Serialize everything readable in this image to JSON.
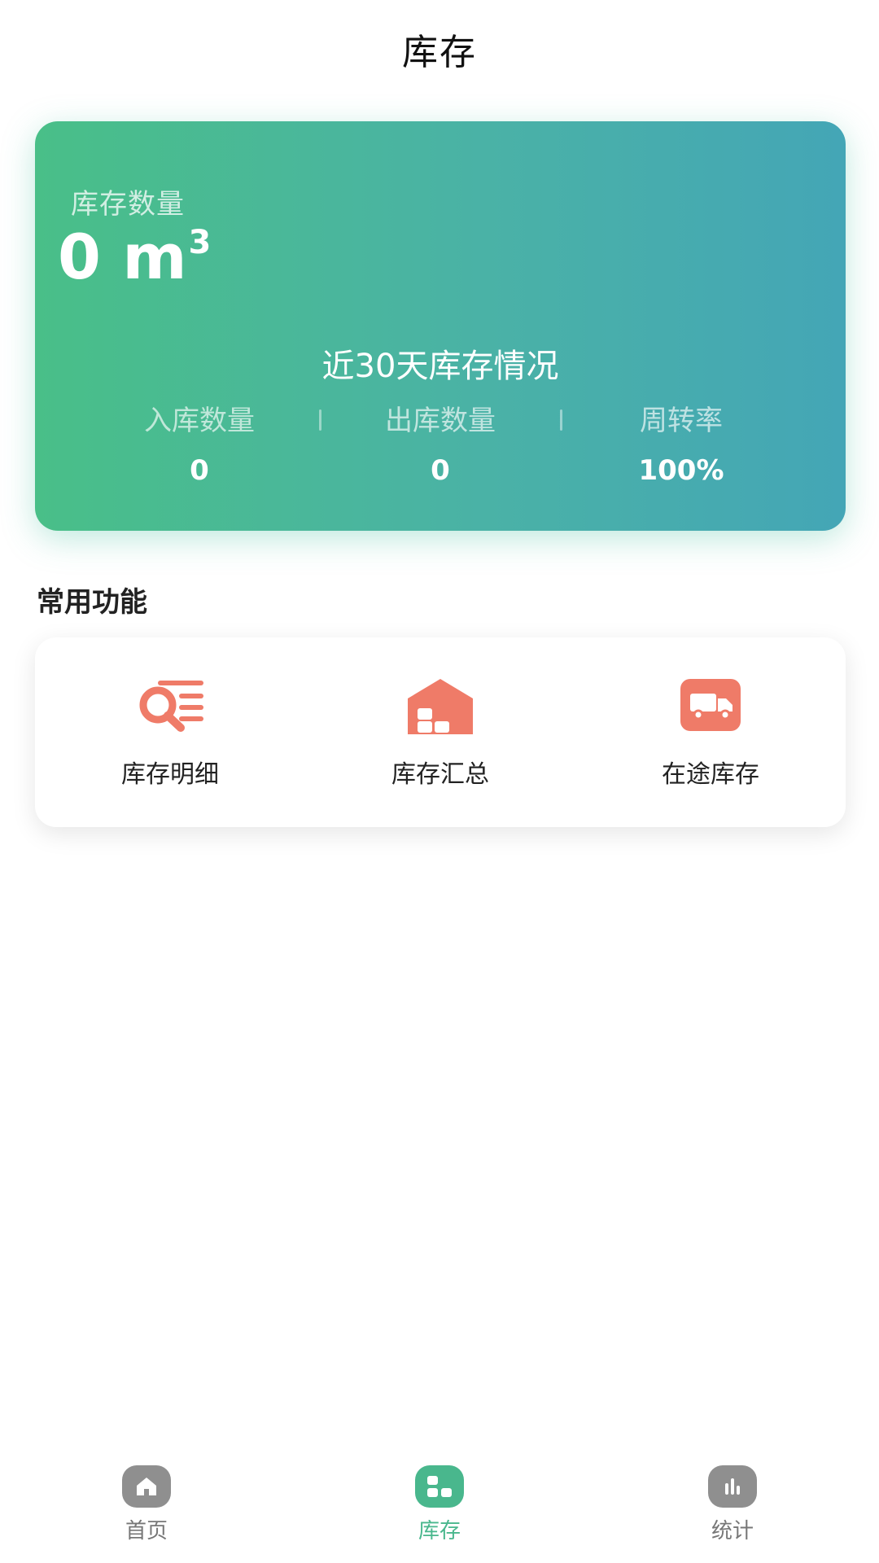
{
  "header": {
    "title": "库存"
  },
  "hero": {
    "stock_label": "库存数量",
    "stock_value": "0 m",
    "stock_unit_sup": "3",
    "section_title": "近30天库存情况",
    "stats": [
      {
        "label": "入库数量",
        "value": "0"
      },
      {
        "label": "出库数量",
        "value": "0"
      },
      {
        "label": "周转率",
        "value": "100%"
      }
    ]
  },
  "functions": {
    "title": "常用功能",
    "items": [
      {
        "label": "库存明细",
        "icon": "search-list-icon"
      },
      {
        "label": "库存汇总",
        "icon": "warehouse-icon"
      },
      {
        "label": "在途库存",
        "icon": "truck-icon"
      }
    ]
  },
  "nav": {
    "items": [
      {
        "label": "首页",
        "icon": "home-icon",
        "active": false
      },
      {
        "label": "库存",
        "icon": "grid-icon",
        "active": true
      },
      {
        "label": "统计",
        "icon": "bar-chart-icon",
        "active": false
      }
    ]
  },
  "colors": {
    "accent": "#49b78d",
    "icon_orange": "#ef7b68",
    "gradient_start": "#49bf88",
    "gradient_end": "#44a6b6"
  }
}
